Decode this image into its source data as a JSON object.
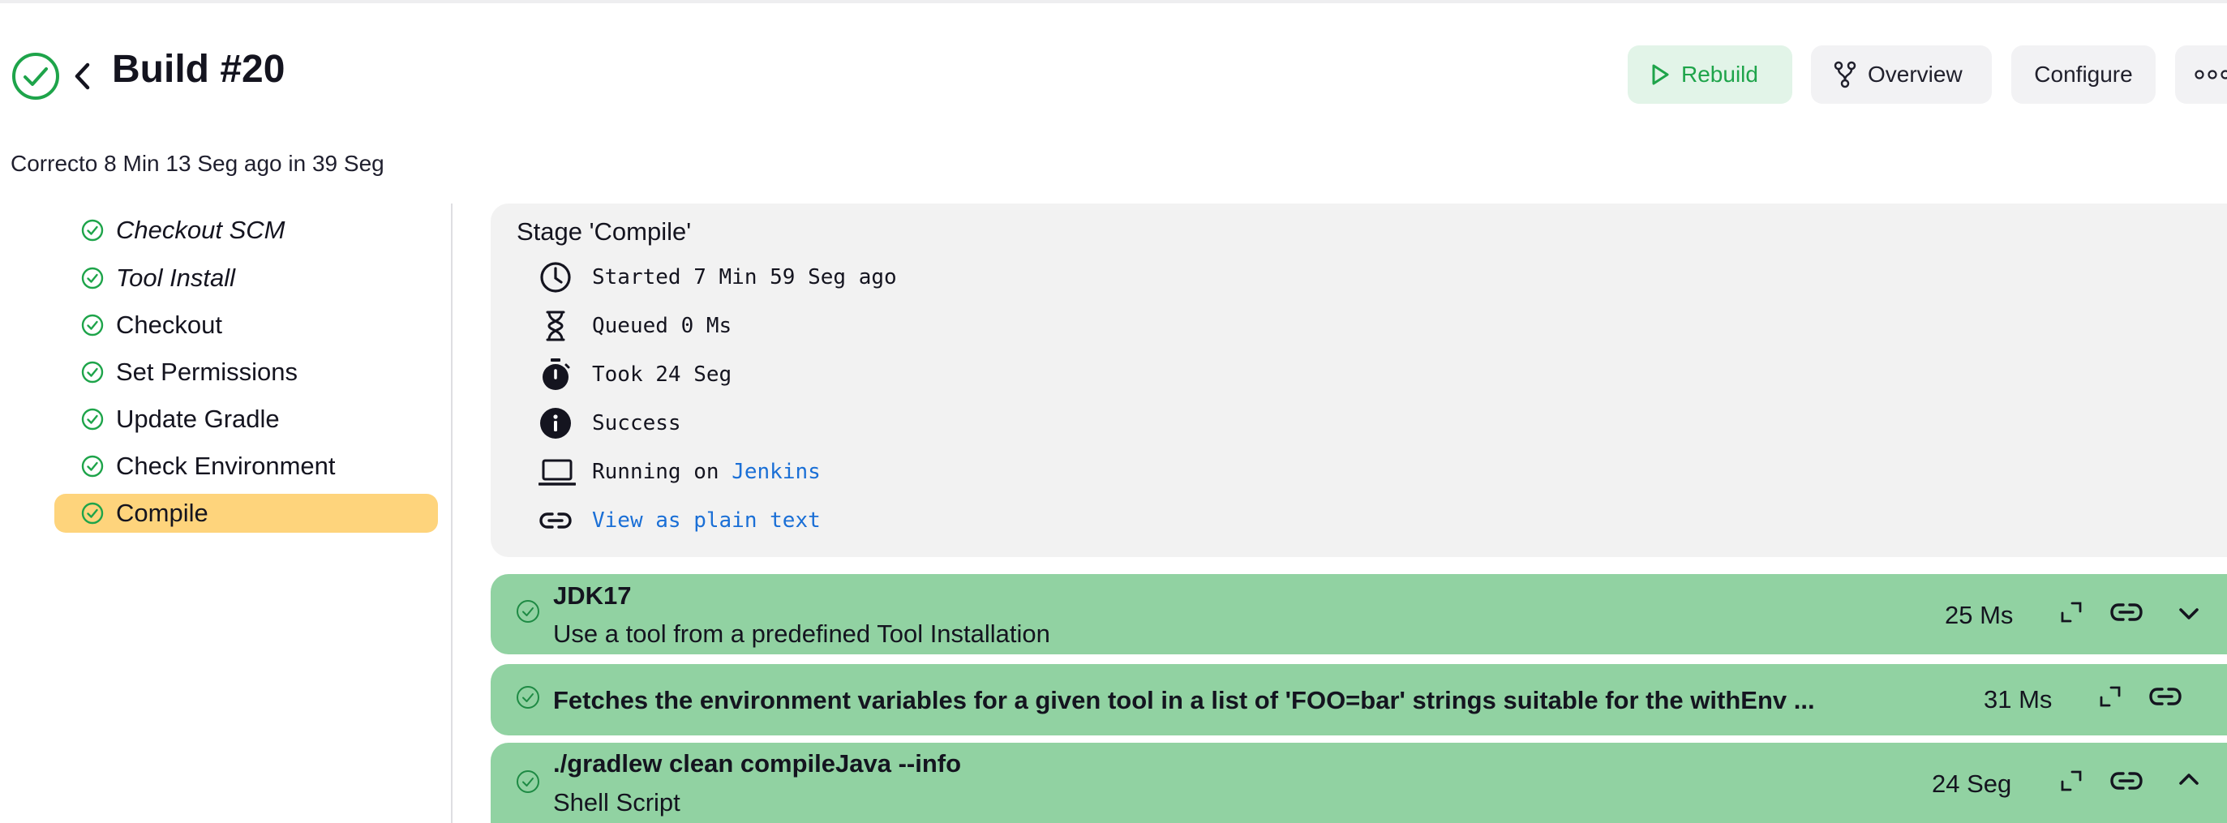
{
  "header": {
    "title": "Build #20",
    "subtitle": "Correcto 8 Min 13 Seg ago in 39 Seg",
    "buttons": {
      "rebuild": "Rebuild",
      "overview": "Overview",
      "configure": "Configure"
    }
  },
  "colors": {
    "success": "#1ea44a",
    "active_stage": "#fed47c",
    "step_bg": "#91d2a2",
    "panel_bg": "#f2f2f2",
    "link": "#1a6fd6"
  },
  "sidebar": {
    "stages": [
      {
        "label": "Checkout SCM",
        "italic": true
      },
      {
        "label": "Tool Install",
        "italic": true
      },
      {
        "label": "Checkout",
        "italic": false
      },
      {
        "label": "Set Permissions",
        "italic": false
      },
      {
        "label": "Update Gradle",
        "italic": false
      },
      {
        "label": "Check Environment",
        "italic": false
      },
      {
        "label": "Compile",
        "italic": false,
        "active": true
      }
    ]
  },
  "stage": {
    "title": "Stage 'Compile'",
    "started": "Started 7 Min 59 Seg ago",
    "queued": "Queued 0 Ms",
    "took": "Took 24 Seg",
    "status": "Success",
    "running_prefix": "Running on",
    "running_node": "Jenkins",
    "plain_text": "View as plain text"
  },
  "steps": [
    {
      "name": "JDK17",
      "description": "Use a tool from a predefined Tool Installation",
      "duration": "25 Ms",
      "toggle": "chevron-down-icon"
    },
    {
      "name": "Fetches the environment variables for a given tool in a list of 'FOO=bar' strings suitable for the withEnv ...",
      "duration": "31 Ms"
    },
    {
      "name": "./gradlew clean compileJava --info",
      "description": "Shell Script",
      "duration": "24 Seg",
      "toggle": "chevron-up-icon"
    }
  ]
}
